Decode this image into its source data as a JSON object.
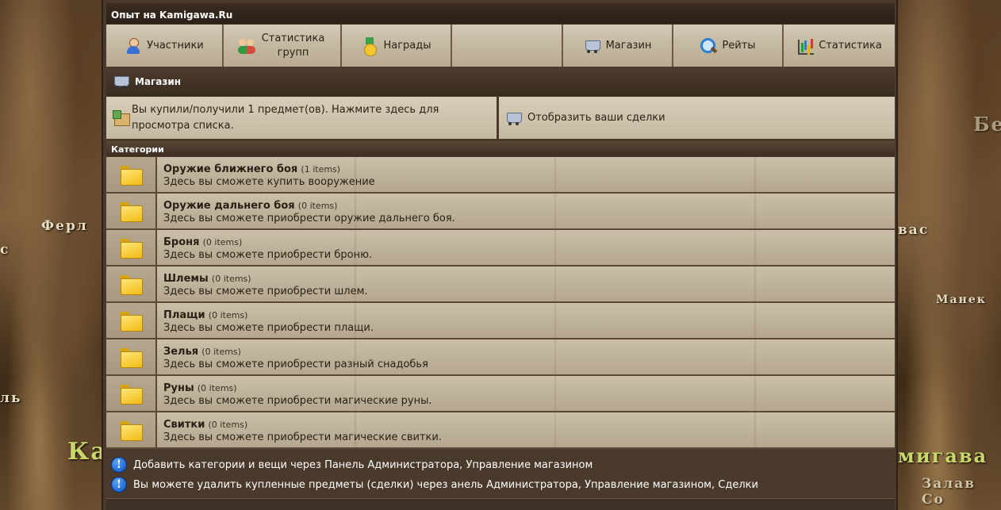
{
  "page_title": "Опыт на Kamigawa.Ru",
  "nav": [
    {
      "label": "Участники",
      "icon": "user-icon",
      "name": "nav-members"
    },
    {
      "label": "Статистика групп",
      "icon": "group-icon",
      "name": "nav-group-stats"
    },
    {
      "label": "Награды",
      "icon": "medal-icon",
      "name": "nav-awards"
    },
    {
      "label": "",
      "icon": "",
      "name": "nav-empty"
    },
    {
      "label": "Магазин",
      "icon": "cart-icon",
      "name": "nav-shop"
    },
    {
      "label": "Рейты",
      "icon": "search-icon",
      "name": "nav-rates"
    },
    {
      "label": "Статистика",
      "icon": "chart-icon",
      "name": "nav-stats"
    }
  ],
  "section": {
    "title": "Магазин",
    "icon": "cart-icon"
  },
  "actions": {
    "purchased": "Вы купили/получили 1 предмет(ов). Нажмите здесь для просмотра списка.",
    "show_deals": "Отобразить ваши сделки"
  },
  "categories_header": "Категории",
  "categories": [
    {
      "name": "Оружие ближнего боя",
      "count": "(1 items)",
      "desc": "Здесь вы сможете купить вооружение"
    },
    {
      "name": "Оружие дальнего боя",
      "count": "(0 items)",
      "desc": "Здесь вы сможете приобрести оружие дальнего боя."
    },
    {
      "name": "Броня",
      "count": "(0 items)",
      "desc": "Здесь вы сможете приобрести броню."
    },
    {
      "name": "Шлемы",
      "count": "(0 items)",
      "desc": "Здесь вы сможете приобрести шлем."
    },
    {
      "name": "Плащи",
      "count": "(0 items)",
      "desc": "Здесь вы сможете приобрести плащи."
    },
    {
      "name": "Зелья",
      "count": "(0 items)",
      "desc": "Здесь вы сможете приобрести разный снадобья"
    },
    {
      "name": "Руны",
      "count": "(0 items)",
      "desc": "Здесь вы сможете приобрести магические руны."
    },
    {
      "name": "Свитки",
      "count": "(0 items)",
      "desc": "Здесь вы сможете приобрести магические свитки."
    }
  ],
  "notes": [
    "Добавить категории и вещи через Панель Администратора, Управление магазином",
    "Вы можете удалить купленные предметы (сделки) через анель Администратора, Управление магазином, Сделки"
  ],
  "map_labels": {
    "left": [
      "Ферл",
      "с",
      "ль",
      "Ка"
    ],
    "right": [
      "Бе",
      "вас",
      "Манек",
      "мигава",
      "Залав Со"
    ]
  },
  "colors": {
    "board": "#4a3a2b",
    "panel": "#c6b9a2",
    "header": "#3a2c1f",
    "info_icon": "#0a4fc0",
    "folder": "#f1bd14"
  }
}
